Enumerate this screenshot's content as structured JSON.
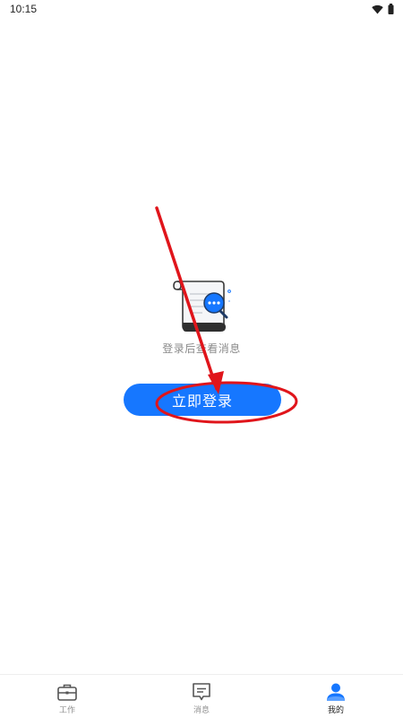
{
  "status_bar": {
    "time": "10:15",
    "icons": [
      "wifi-icon",
      "battery-icon"
    ]
  },
  "empty_state": {
    "illustration": "document-search-illustration",
    "message": "登录后查看消息",
    "login_button_label": "立即登录"
  },
  "tab_bar": {
    "active_index": 2,
    "items": [
      {
        "label": "工作",
        "icon": "briefcase-icon"
      },
      {
        "label": "消息",
        "icon": "message-icon"
      },
      {
        "label": "我的",
        "icon": "person-icon"
      }
    ]
  },
  "colors": {
    "primary": "#1677ff",
    "annotation": "#e0151b",
    "muted_text": "#8a8a8a"
  }
}
